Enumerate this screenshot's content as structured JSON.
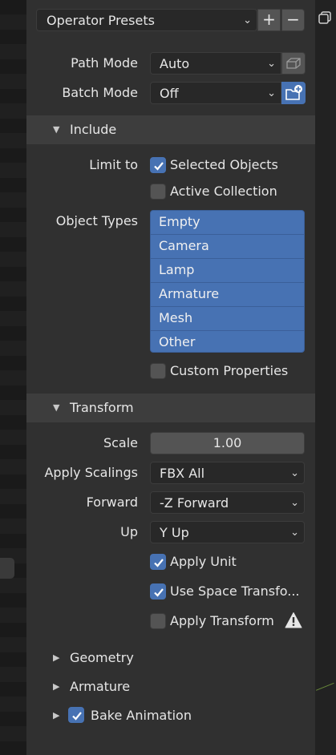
{
  "presets": {
    "label": "Operator Presets",
    "add": "+",
    "remove": "−"
  },
  "path_mode": {
    "label": "Path Mode",
    "value": "Auto"
  },
  "batch_mode": {
    "label": "Batch Mode",
    "value": "Off"
  },
  "include": {
    "title": "Include",
    "limit_to_label": "Limit to",
    "selected_objects": {
      "label": "Selected Objects",
      "checked": true
    },
    "active_collection": {
      "label": "Active Collection",
      "checked": false
    },
    "object_types_label": "Object Types",
    "object_types": [
      "Empty",
      "Camera",
      "Lamp",
      "Armature",
      "Mesh",
      "Other"
    ],
    "custom_properties": {
      "label": "Custom Properties",
      "checked": false
    }
  },
  "transform": {
    "title": "Transform",
    "scale_label": "Scale",
    "scale_value": "1.00",
    "apply_scalings_label": "Apply Scalings",
    "apply_scalings_value": "FBX All",
    "forward_label": "Forward",
    "forward_value": "-Z Forward",
    "up_label": "Up",
    "up_value": "Y Up",
    "apply_unit": {
      "label": "Apply Unit",
      "checked": true
    },
    "use_space_transform": {
      "label": "Use Space Transfo...",
      "checked": true
    },
    "apply_transform": {
      "label": "Apply Transform",
      "checked": false
    }
  },
  "geometry": {
    "title": "Geometry"
  },
  "armature": {
    "title": "Armature"
  },
  "bake_animation": {
    "title": "Bake Animation",
    "checked": true
  },
  "icons": {
    "dropdown": "chevron-down-icon",
    "expanded": "triangle-down-icon",
    "collapsed": "triangle-right-icon",
    "warning": "warning-icon",
    "check": "check-icon"
  },
  "colors": {
    "panel": "#303030",
    "header": "#3d3d3d",
    "field": "#282828",
    "button": "#545454",
    "accent": "#4772b3"
  }
}
